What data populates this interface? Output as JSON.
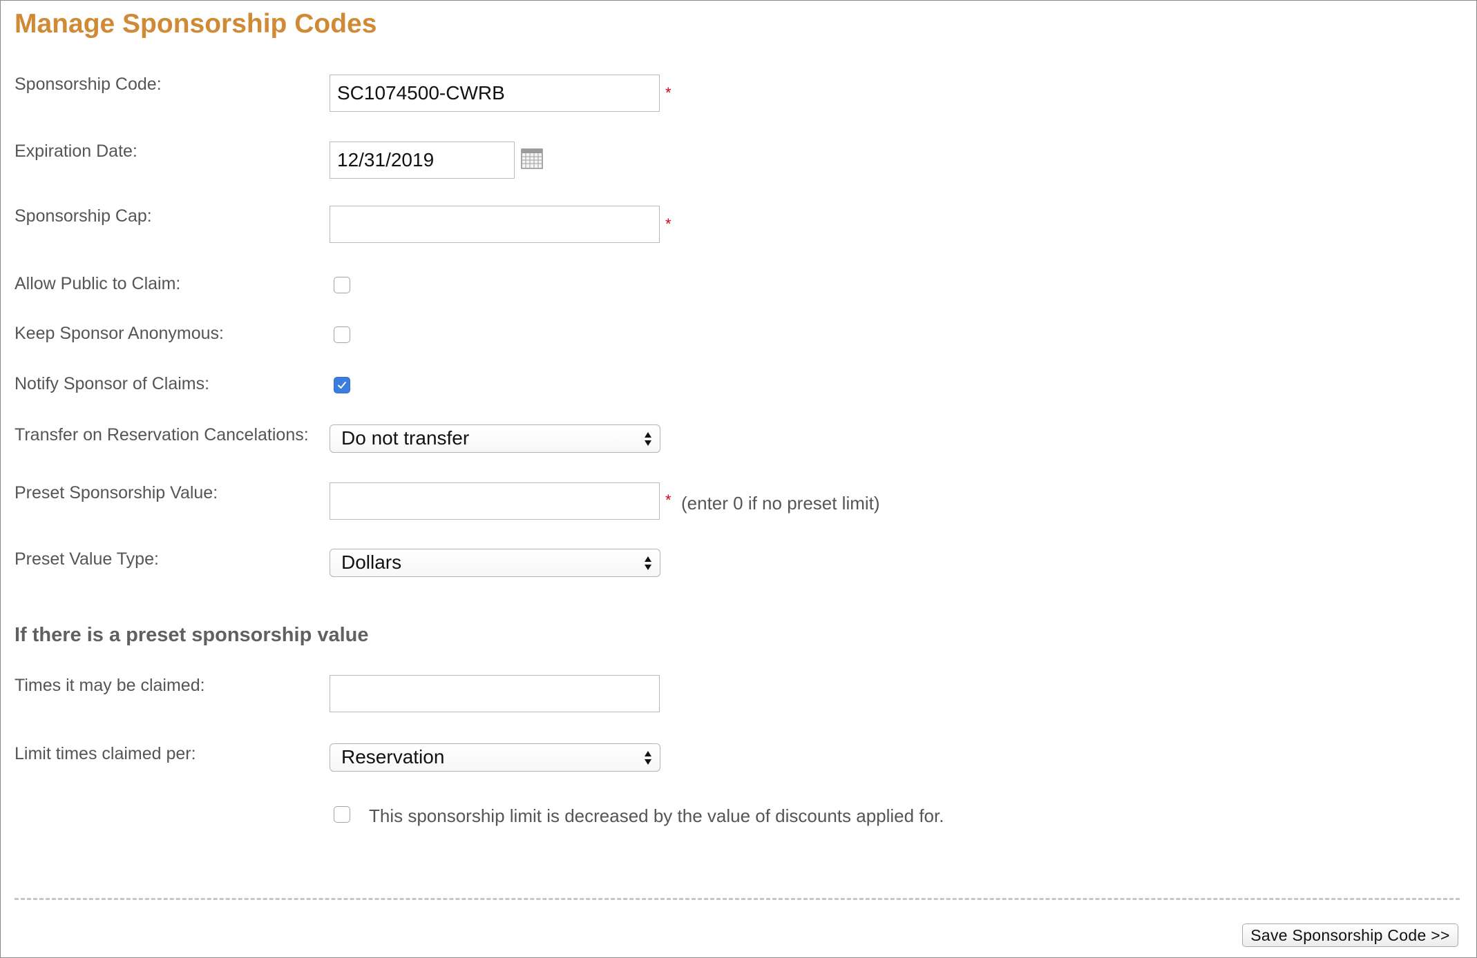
{
  "page": {
    "title": "Manage Sponsorship Codes"
  },
  "form": {
    "sponsorship_code": {
      "label": "Sponsorship Code:",
      "value": "SC1074500-CWRB",
      "required_marker": "*"
    },
    "expiration_date": {
      "label": "Expiration Date:",
      "value": "12/31/2019",
      "icon": "calendar-icon"
    },
    "sponsorship_cap": {
      "label": "Sponsorship Cap:",
      "value": "",
      "required_marker": "*"
    },
    "allow_public_to_claim": {
      "label": "Allow Public to Claim:",
      "checked": false
    },
    "keep_sponsor_anonymous": {
      "label": "Keep Sponsor Anonymous:",
      "checked": false
    },
    "notify_sponsor_of_claims": {
      "label": "Notify Sponsor of Claims:",
      "checked": true
    },
    "transfer_on_cancelations": {
      "label": "Transfer on Reservation Cancelations:",
      "selected": "Do not transfer"
    },
    "preset_sponsorship_value": {
      "label": "Preset Sponsorship Value:",
      "value": "",
      "required_marker": "*",
      "hint": "(enter 0 if no preset limit)"
    },
    "preset_value_type": {
      "label": "Preset Value Type:",
      "selected": "Dollars"
    }
  },
  "preset_section": {
    "heading": "If there is a preset sponsorship value",
    "times_claimed": {
      "label": "Times it may be claimed:",
      "value": ""
    },
    "limit_claimed_per": {
      "label": "Limit times claimed per:",
      "selected": "Reservation"
    },
    "discount_note": {
      "label": "This sponsorship limit is decreased by the value of discounts applied for.",
      "checked": false
    }
  },
  "actions": {
    "save_label": "Save Sponsorship Code >>"
  },
  "colors": {
    "title": "#d08a35",
    "required": "#d0021b",
    "checkbox_checked": "#3b7ddd",
    "label_text": "#555555"
  }
}
